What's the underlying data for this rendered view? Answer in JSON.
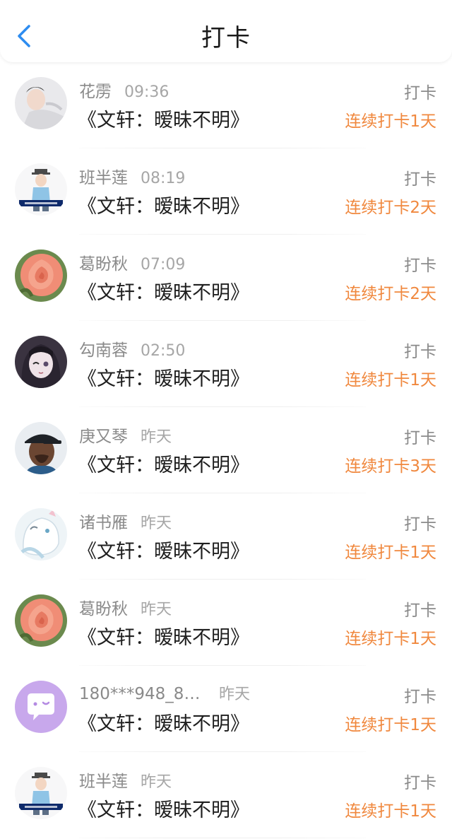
{
  "header": {
    "title": "打卡",
    "back_icon": "chevron-left-icon",
    "accent": "#2d8cf0"
  },
  "colors": {
    "streak": "#f0883e",
    "secondary": "#8a8a8a"
  },
  "items": [
    {
      "user": "花雳",
      "time": "09:36",
      "book": "《文轩：暧昧不明》",
      "action": "打卡",
      "streak": "连续打卡1天",
      "avatar": "person-lying-avatar"
    },
    {
      "user": "班半莲",
      "time": "08:19",
      "book": "《文轩：暧昧不明》",
      "action": "打卡",
      "streak": "连续打卡2天",
      "avatar": "cartoon-boy-avatar"
    },
    {
      "user": "葛盼秋",
      "time": "07:09",
      "book": "《文轩：暧昧不明》",
      "action": "打卡",
      "streak": "连续打卡2天",
      "avatar": "rose-avatar"
    },
    {
      "user": "勾南蓉",
      "time": "02:50",
      "book": "《文轩：暧昧不明》",
      "action": "打卡",
      "streak": "连续打卡1天",
      "avatar": "anime-girl-avatar"
    },
    {
      "user": "庚又琴",
      "time": "昨天",
      "book": "《文轩：暧昧不明》",
      "action": "打卡",
      "streak": "连续打卡3天",
      "avatar": "cap-man-avatar"
    },
    {
      "user": "诸书雁",
      "time": "昨天",
      "book": "《文轩：暧昧不明》",
      "action": "打卡",
      "streak": "连续打卡1天",
      "avatar": "white-character-avatar"
    },
    {
      "user": "葛盼秋",
      "time": "昨天",
      "book": "《文轩：暧昧不明》",
      "action": "打卡",
      "streak": "连续打卡1天",
      "avatar": "rose-avatar"
    },
    {
      "user": "180***948_81...",
      "time": "昨天",
      "book": "《文轩：暧昧不明》",
      "action": "打卡",
      "streak": "连续打卡1天",
      "avatar": "chat-bubble-avatar"
    },
    {
      "user": "班半莲",
      "time": "昨天",
      "book": "《文轩：暧昧不明》",
      "action": "打卡",
      "streak": "连续打卡1天",
      "avatar": "cartoon-boy-avatar"
    }
  ]
}
